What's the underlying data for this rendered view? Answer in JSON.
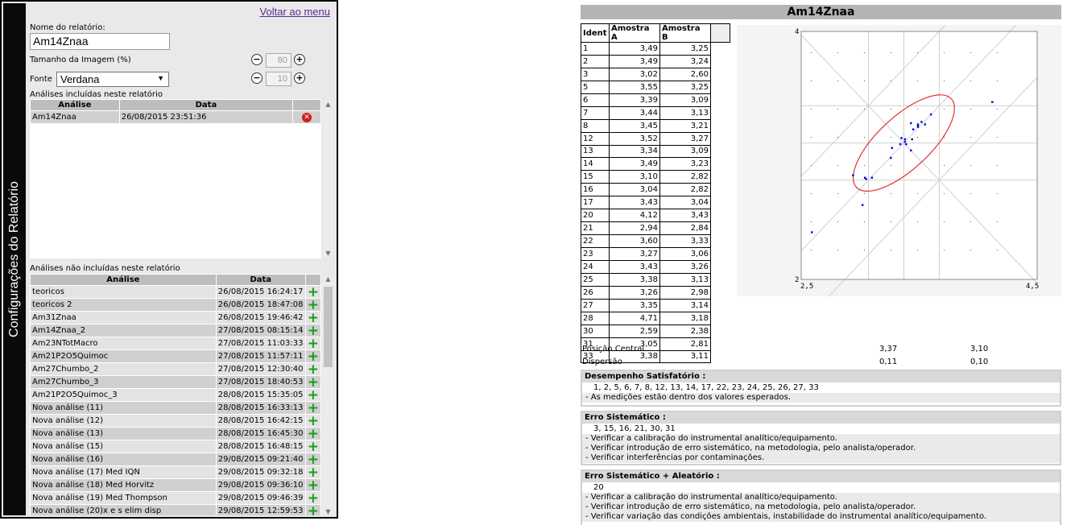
{
  "sidebar_tab": "Configurações do Relatório",
  "back_link": "Voltar ao menu",
  "settings": {
    "report_name_label": "Nome do relatório:",
    "report_name_value": "Am14Znaa",
    "image_size_label": "Tamanho da Imagem (%)",
    "image_size_value": "80",
    "font_label": "Fonte",
    "font_value": "Verdana",
    "font_size_value": "10"
  },
  "included": {
    "title": "Análises incluídas neste relatório",
    "headers": [
      "Análise",
      "Data"
    ],
    "rows": [
      [
        "Am14Znaa",
        "26/08/2015 23:51:36"
      ]
    ]
  },
  "excluded": {
    "title": "Análises não incluídas neste relatório",
    "headers": [
      "Análise",
      "Data"
    ],
    "rows": [
      [
        "teoricos",
        "26/08/2015 16:24:17"
      ],
      [
        "teoricos 2",
        "26/08/2015 18:47:08"
      ],
      [
        "Am31Znaa",
        "26/08/2015 19:46:42"
      ],
      [
        "Am14Znaa_2",
        "27/08/2015 08:15:14"
      ],
      [
        "Am23NTotMacro",
        "27/08/2015 11:03:33"
      ],
      [
        "Am21P2O5Quimoc",
        "27/08/2015 11:57:11"
      ],
      [
        "Am27Chumbo_2",
        "27/08/2015 12:30:40"
      ],
      [
        "Am27Chumbo_3",
        "27/08/2015 18:40:53"
      ],
      [
        "Am21P2O5Quimoc_3",
        "28/08/2015 15:35:05"
      ],
      [
        "Nova análise (11)",
        "28/08/2015 16:33:13"
      ],
      [
        "Nova análise (12)",
        "28/08/2015 16:42:15"
      ],
      [
        "Nova análise (13)",
        "28/08/2015 16:45:30"
      ],
      [
        "Nova análise (15)",
        "28/08/2015 16:48:15"
      ],
      [
        "Nova análise (16)",
        "29/08/2015 09:21:40"
      ],
      [
        "Nova análise (17) Med IQN",
        "29/08/2015 09:32:18"
      ],
      [
        "Nova análise (18) Med Horvitz",
        "29/08/2015 09:36:10"
      ],
      [
        "Nova análise (19) Med Thompson",
        "29/08/2015 09:46:39"
      ],
      [
        "Nova análise (20)x e s elim disp",
        "29/08/2015 12:59:53"
      ]
    ]
  },
  "report": {
    "title": "Am14Znaa",
    "table_headers": [
      "Ident",
      "Amostra A",
      "Amostra B"
    ],
    "rows": [
      [
        "1",
        "3,49",
        "3,25"
      ],
      [
        "2",
        "3,49",
        "3,24"
      ],
      [
        "3",
        "3,02",
        "2,60"
      ],
      [
        "5",
        "3,55",
        "3,25"
      ],
      [
        "6",
        "3,39",
        "3,09"
      ],
      [
        "7",
        "3,44",
        "3,13"
      ],
      [
        "8",
        "3,45",
        "3,21"
      ],
      [
        "12",
        "3,52",
        "3,27"
      ],
      [
        "13",
        "3,34",
        "3,09"
      ],
      [
        "14",
        "3,49",
        "3,23"
      ],
      [
        "15",
        "3,10",
        "2,82"
      ],
      [
        "16",
        "3,04",
        "2,82"
      ],
      [
        "17",
        "3,43",
        "3,04"
      ],
      [
        "20",
        "4,12",
        "3,43"
      ],
      [
        "21",
        "2,94",
        "2,84"
      ],
      [
        "22",
        "3,60",
        "3,33"
      ],
      [
        "23",
        "3,27",
        "3,06"
      ],
      [
        "24",
        "3,43",
        "3,26"
      ],
      [
        "25",
        "3,38",
        "3,13"
      ],
      [
        "26",
        "3,26",
        "2,98"
      ],
      [
        "27",
        "3,35",
        "3,14"
      ],
      [
        "28",
        "4,71",
        "3,18"
      ],
      [
        "30",
        "2,59",
        "2,38"
      ],
      [
        "31",
        "3,05",
        "2,81"
      ],
      [
        "33",
        "3,38",
        "3,11"
      ]
    ],
    "central_label": "Posição Central",
    "central_a": "3,37",
    "central_b": "3,10",
    "dispersion_label": "Dispersão",
    "dispersion_a": "0,11",
    "dispersion_b": "0,10"
  },
  "chart_data": {
    "type": "scatter",
    "xlim": [
      2.5,
      4.5
    ],
    "ylim": [
      2,
      4
    ],
    "tick_labels": {
      "x_min": "2,5",
      "x_max": "4,5",
      "y_min": "2",
      "y_max": "4"
    },
    "center": [
      3.37,
      3.1
    ],
    "point_color": "#0000dd",
    "ellipse_color": "#e03030",
    "points": [
      [
        3.49,
        3.25
      ],
      [
        3.49,
        3.24
      ],
      [
        3.02,
        2.6
      ],
      [
        3.55,
        3.25
      ],
      [
        3.39,
        3.09
      ],
      [
        3.44,
        3.13
      ],
      [
        3.45,
        3.21
      ],
      [
        3.52,
        3.27
      ],
      [
        3.34,
        3.09
      ],
      [
        3.49,
        3.23
      ],
      [
        3.1,
        2.82
      ],
      [
        3.04,
        2.82
      ],
      [
        3.43,
        3.04
      ],
      [
        4.12,
        3.43
      ],
      [
        2.94,
        2.84
      ],
      [
        3.6,
        3.33
      ],
      [
        3.27,
        3.06
      ],
      [
        3.43,
        3.26
      ],
      [
        3.38,
        3.13
      ],
      [
        3.26,
        2.98
      ],
      [
        3.35,
        3.14
      ],
      [
        4.71,
        3.18
      ],
      [
        2.59,
        2.38
      ],
      [
        3.05,
        2.81
      ],
      [
        3.38,
        3.11
      ]
    ]
  },
  "findings": [
    {
      "title": "Desempenho Satisfatório :",
      "ids": "1, 2, 5, 6, 7, 8, 12, 13, 14, 17, 22, 23, 24, 25, 26, 27, 33",
      "notes": [
        "- As medições estão dentro dos valores esperados."
      ]
    },
    {
      "title": "Erro Sistemático :",
      "ids": "3, 15, 16, 21, 30, 31",
      "notes": [
        "- Verificar a calibração do instrumental analítico/equipamento.",
        "- Verificar introdução de erro sistemático, na metodologia, pelo analista/operador.",
        "- Verificar interferências por contaminações."
      ]
    },
    {
      "title": "Erro Sistemático + Aleatório :",
      "ids": "20",
      "notes": [
        "- Verificar a calibração do instrumental analítico/equipamento.",
        "- Verificar introdução de erro sistemático, na metodologia, pelo analista/operador.",
        "- Verificar variação das condições ambientais, instabilidade do instrumental analítico/equipamento."
      ]
    }
  ]
}
